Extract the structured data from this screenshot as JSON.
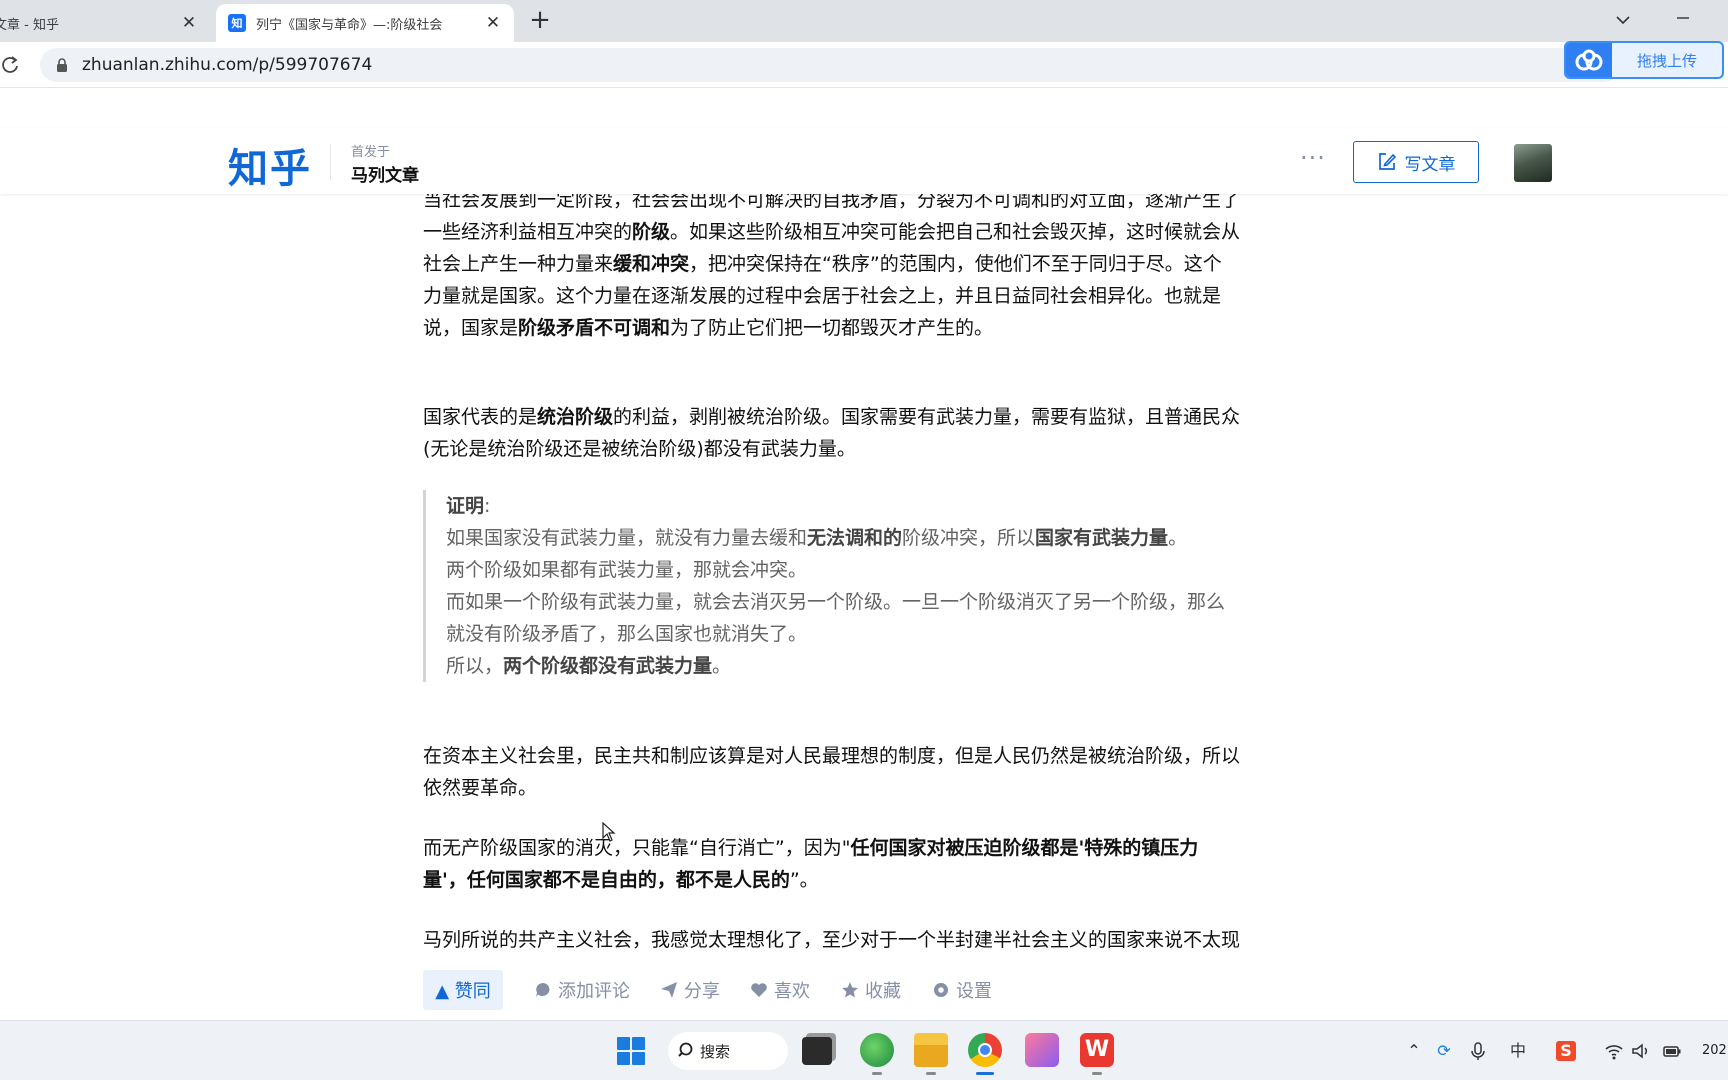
{
  "browser": {
    "tabs": [
      {
        "title": "文章 - 知乎",
        "active": false
      },
      {
        "title": "列宁《国家与革命》—:阶级社会",
        "active": true,
        "favicon": "知"
      }
    ],
    "url": "zhuanlan.zhihu.com/p/599707674",
    "extension": {
      "label": "拖拽上传"
    }
  },
  "zhihu": {
    "logo": "知乎",
    "published_label": "首发于",
    "column_name": "马列文章",
    "more": "···",
    "write_label": "写文章"
  },
  "article": {
    "p0": [
      "当社会发展到一定阶段，社会会出现不可解决的自我矛盾，分裂为不可调和的对立面，逐渐产生了",
      [
        "一些经济利益相互冲突的",
        "阶级",
        "。如果这些阶级相互冲突可能会把自己和社会毁灭掉，这时候就会从"
      ],
      [
        "社会上产生一种力量来",
        "缓和冲突",
        "，把冲突保持在“秩序”的范围内，使他们不至于同归于尽。这个"
      ],
      "力量就是国家。这个力量在逐渐发展的过程中会居于社会之上，并且日益同社会相异化。也就是",
      [
        "说，国家是",
        "阶级矛盾不可调和",
        "为了防止它们把一切都毁灭才产生的。"
      ]
    ],
    "p1": [
      [
        "国家代表的是",
        "统治阶级",
        "的利益，剥削被统治阶级。国家需要有武装力量，需要有监狱，且普通民众"
      ],
      "(无论是统治阶级还是被统治阶级)都没有武装力量。"
    ],
    "quote": {
      "heading": "证明",
      "heading_colon": ":",
      "l1": [
        "如果国家没有武装力量，就没有力量去缓和",
        "无法调和的",
        "阶级冲突，所以",
        "国家有武装力量",
        "。"
      ],
      "l2": "两个阶级如果都有武装力量，那就会冲突。",
      "l3": "而如果一个阶级有武装力量，就会去消灭另一个阶级。一旦一个阶级消灭了另一个阶级，那么",
      "l4": "就没有阶级矛盾了，那么国家也就消失了。",
      "l5": [
        "所以，",
        "两个阶级都没有武装力量",
        "。"
      ]
    },
    "p2": [
      "在资本主义社会里，民主共和制应该算是对人民最理想的制度，但是人民仍然是被统治阶级，所以",
      "依然要革命。"
    ],
    "p3": [
      [
        "而无产阶级国家的消灭，只能靠“自行消亡”，因为\"",
        "任何国家对被压迫阶级都是'特殊的镇压力"
      ],
      [
        "量'，任何国家都不是自由的，都不是人民的",
        "”。"
      ]
    ],
    "p4": "马列所说的共产主义社会，我感觉太理想化了，至少对于一个半封建半社会主义的国家来说不太现"
  },
  "actions": {
    "upvote": "▲ 赞同",
    "comment": "添加评论",
    "share": "分享",
    "like": "喜欢",
    "collect": "收藏",
    "settings": "设置"
  },
  "taskbar": {
    "search_label": "搜索",
    "ime": "中",
    "clock": "202"
  },
  "colors": {
    "zhihu_blue": "#0f68d6",
    "quote_text": "#646464",
    "meta_gray": "#8590a6"
  }
}
